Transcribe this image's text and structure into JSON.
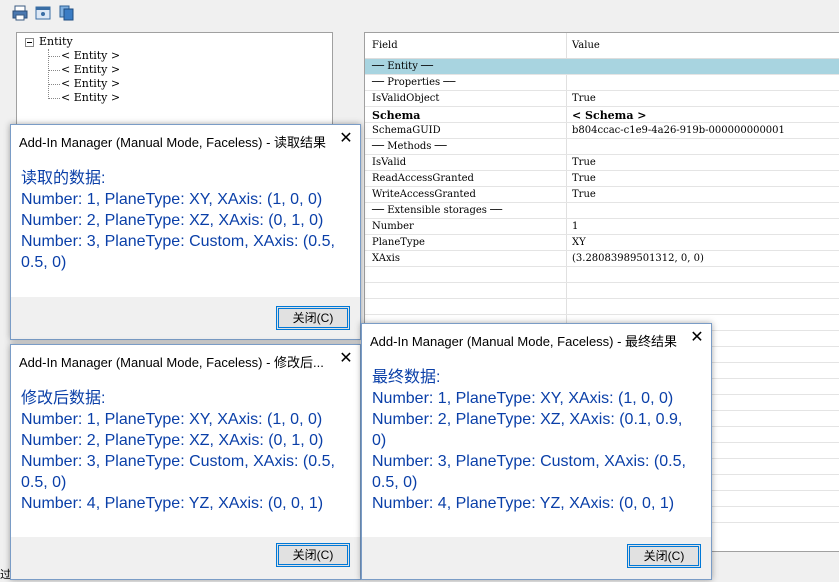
{
  "toolbar": {
    "print_icon": "printer-icon",
    "properties_icon": "window-icon",
    "copy_icon": "copy-icon"
  },
  "tree": {
    "root_label": "Entity",
    "children": [
      "< Entity >",
      "< Entity >",
      "< Entity >",
      "< Entity >"
    ]
  },
  "grid": {
    "header_field": "Field",
    "header_value": "Value",
    "rows": [
      {
        "field": "── Entity ──",
        "value": ""
      },
      {
        "field": "  ── Properties ──",
        "value": ""
      },
      {
        "field": "IsValidObject",
        "value": "True"
      },
      {
        "field": "Schema",
        "value": "< Schema >"
      },
      {
        "field": "SchemaGUID",
        "value": "b804ccac-c1e9-4a26-919b-000000000001"
      },
      {
        "field": "  ── Methods ──",
        "value": ""
      },
      {
        "field": "IsValid",
        "value": "True"
      },
      {
        "field": "ReadAccessGranted",
        "value": "True"
      },
      {
        "field": "WriteAccessGranted",
        "value": "True"
      },
      {
        "field": "── Extensible storages ──",
        "value": ""
      },
      {
        "field": "Number",
        "value": "1"
      },
      {
        "field": "PlaneType",
        "value": "XY"
      },
      {
        "field": "XAxis",
        "value": "(3.28083989501312, 0, 0)"
      }
    ]
  },
  "dialog_read": {
    "title": "Add-In Manager (Manual Mode, Faceless) - 读取结果",
    "lines": [
      "读取的数据:",
      "Number: 1, PlaneType: XY, XAxis: (1, 0, 0)",
      "Number: 2, PlaneType: XZ, XAxis: (0, 1, 0)",
      "Number: 3, PlaneType: Custom, XAxis: (0.5,",
      "0.5, 0)"
    ],
    "button": "关闭(C)"
  },
  "dialog_modified": {
    "title": "Add-In Manager (Manual Mode, Faceless) - 修改后...",
    "lines": [
      "修改后数据:",
      "Number: 1, PlaneType: XY, XAxis: (1, 0, 0)",
      "Number: 2, PlaneType: XZ, XAxis: (0, 1, 0)",
      "Number: 3, PlaneType: Custom, XAxis: (0.5,",
      "0.5, 0)",
      "Number: 4, PlaneType: YZ, XAxis: (0, 0, 1)"
    ],
    "button": "关闭(C)"
  },
  "dialog_final": {
    "title": "Add-In Manager (Manual Mode, Faceless) - 最终结果",
    "lines": [
      "最终数据:",
      "Number: 1, PlaneType: XY, XAxis: (1, 0, 0)",
      "Number: 2, PlaneType: XZ, XAxis: (0.1, 0.9,",
      "0)",
      "Number: 3, PlaneType: Custom, XAxis: (0.5,",
      "0.5, 0)",
      "Number: 4, PlaneType: YZ, XAxis: (0, 0, 1)"
    ],
    "button": "关闭(C)"
  },
  "status_text": "过",
  "colors": {
    "accent": "#0078d7",
    "message_text": "#0a3fa8",
    "selected_row": "#a8d4e0"
  }
}
